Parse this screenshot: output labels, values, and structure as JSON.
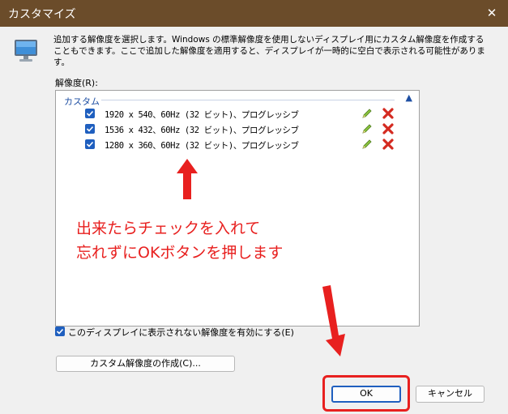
{
  "window": {
    "title": "カスタマイズ",
    "close_glyph": "✕"
  },
  "description": "追加する解像度を選択します。Windows の標準解像度を使用しないディスプレイ用にカスタム解像度を作成することもできます。ここで追加した解像度を適用すると、ディスプレイが一時的に空白で表示される可能性があります。",
  "resolution_label": "解像度(R):",
  "group": {
    "name": "カスタム",
    "collapse_glyph": "▲"
  },
  "resolutions": [
    {
      "text": "1920 x 540、60Hz (32 ビット)、プログレッシブ",
      "checked": true
    },
    {
      "text": "1536 x 432、60Hz (32 ビット)、プログレッシブ",
      "checked": true
    },
    {
      "text": "1280 x 360、60Hz (32 ビット)、プログレッシブ",
      "checked": true
    }
  ],
  "annotation": {
    "line1": "出来たらチェックを入れて",
    "line2": "忘れずにOKボタンを押します",
    "color": "#e8201f"
  },
  "enable_hidden_checkbox": {
    "label": "このディスプレイに表示されない解像度を有効にする(E)",
    "checked": true
  },
  "buttons": {
    "create_custom": "カスタム解像度の作成(C)...",
    "ok": "OK",
    "cancel": "キャンセル"
  },
  "colors": {
    "titlebar": "#6b4c2a",
    "accent": "#1f5fbf",
    "highlight": "#e8201f"
  }
}
